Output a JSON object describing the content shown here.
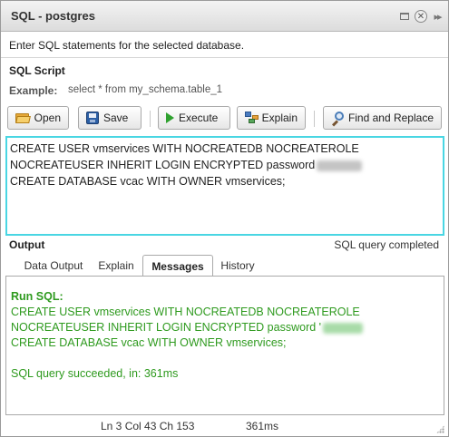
{
  "window": {
    "title": "SQL - postgres",
    "description": "Enter SQL statements for the selected database."
  },
  "sql_script": {
    "heading": "SQL Script",
    "example_label": "Example:",
    "example_text": "select * from my_schema.table_1"
  },
  "toolbar": {
    "open_label": "Open",
    "save_label": "Save",
    "execute_label": "Execute",
    "explain_label": "Explain",
    "find_replace_label": "Find and Replace"
  },
  "editor": {
    "lines": [
      "CREATE USER vmservices WITH NOCREATEDB NOCREATEROLE",
      "NOCREATEUSER INHERIT LOGIN ENCRYPTED password",
      "CREATE DATABASE vcac WITH OWNER vmservices;"
    ]
  },
  "output": {
    "heading": "Output",
    "status": "SQL query completed",
    "tabs": [
      "Data Output",
      "Explain",
      "Messages",
      "History"
    ],
    "active_tab": "Messages",
    "messages": {
      "run_label": "Run SQL:",
      "lines": [
        "CREATE USER vmservices WITH NOCREATEDB NOCREATEROLE",
        "NOCREATEUSER INHERIT LOGIN ENCRYPTED password '",
        "CREATE DATABASE vcac WITH OWNER vmservices;"
      ],
      "result": "SQL query succeeded, in: 361ms"
    }
  },
  "statusbar": {
    "position": "Ln 3 Col 43 Ch 153",
    "time": "361ms"
  },
  "colors": {
    "editor_border": "#49d6e3",
    "message_text": "#2e9a1e"
  }
}
